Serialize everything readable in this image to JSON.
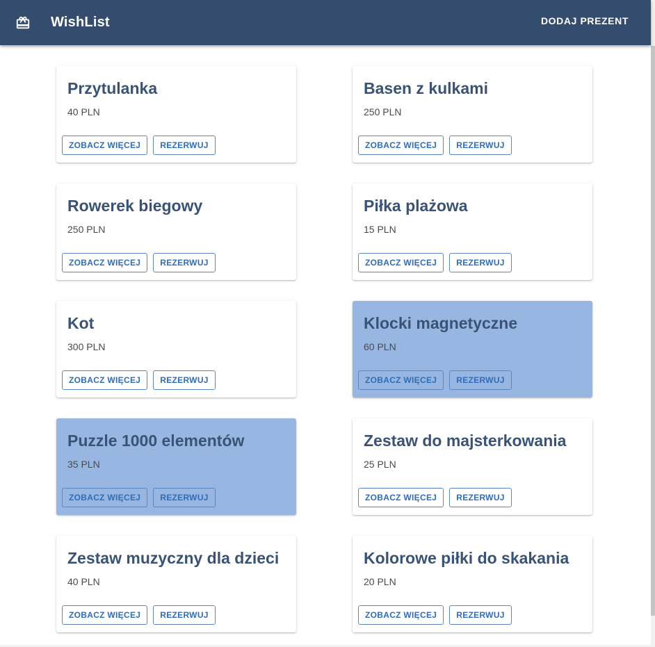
{
  "app": {
    "title": "WishList",
    "add_button_label": "DODAJ PREZENT",
    "logo_icon": "gift-card-icon",
    "colors": {
      "appbar": "#344c6e",
      "card_highlight": "#97b6e2",
      "button_text": "#2f6db6",
      "title_text": "#3a5375"
    }
  },
  "gifts": [
    {
      "name": "Przytulanka",
      "price": "40 PLN",
      "highlighted": false,
      "more_label": "ZOBACZ WIĘCEJ",
      "reserve_label": "REZERWUJ"
    },
    {
      "name": "Basen z kulkami",
      "price": "250 PLN",
      "highlighted": false,
      "more_label": "ZOBACZ WIĘCEJ",
      "reserve_label": "REZERWUJ"
    },
    {
      "name": "Rowerek biegowy",
      "price": "250 PLN",
      "highlighted": false,
      "more_label": "ZOBACZ WIĘCEJ",
      "reserve_label": "REZERWUJ"
    },
    {
      "name": "Piłka plażowa",
      "price": "15 PLN",
      "highlighted": false,
      "more_label": "ZOBACZ WIĘCEJ",
      "reserve_label": "REZERWUJ"
    },
    {
      "name": "Kot",
      "price": "300 PLN",
      "highlighted": false,
      "more_label": "ZOBACZ WIĘCEJ",
      "reserve_label": "REZERWUJ"
    },
    {
      "name": "Klocki magnetyczne",
      "price": "60 PLN",
      "highlighted": true,
      "more_label": "ZOBACZ WIĘCEJ",
      "reserve_label": "REZERWUJ"
    },
    {
      "name": "Puzzle 1000 elementów",
      "price": "35 PLN",
      "highlighted": true,
      "more_label": "ZOBACZ WIĘCEJ",
      "reserve_label": "REZERWUJ"
    },
    {
      "name": "Zestaw do majsterkowania",
      "price": "25 PLN",
      "highlighted": false,
      "more_label": "ZOBACZ WIĘCEJ",
      "reserve_label": "REZERWUJ"
    },
    {
      "name": "Zestaw muzyczny dla dzieci",
      "price": "40 PLN",
      "highlighted": false,
      "more_label": "ZOBACZ WIĘCEJ",
      "reserve_label": "REZERWUJ"
    },
    {
      "name": "Kolorowe piłki do skakania",
      "price": "20 PLN",
      "highlighted": false,
      "more_label": "ZOBACZ WIĘCEJ",
      "reserve_label": "REZERWUJ"
    }
  ]
}
